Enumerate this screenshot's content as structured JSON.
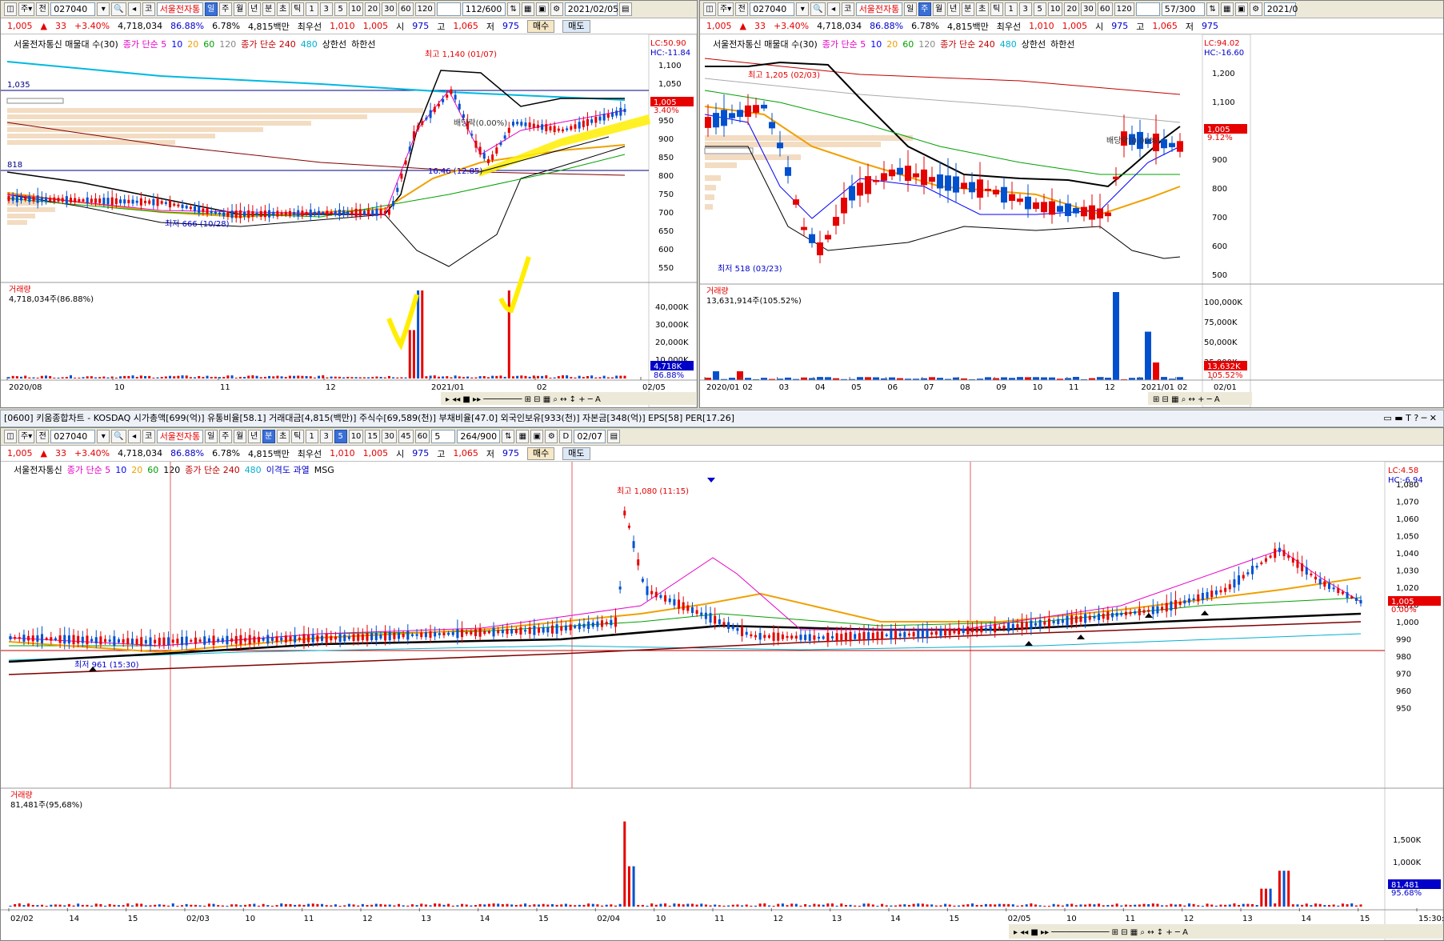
{
  "common": {
    "code": "027040",
    "name": "서울전자통",
    "mode_labels": [
      "일",
      "주",
      "월",
      "년",
      "분",
      "초",
      "틱"
    ],
    "periods_daily": [
      "1",
      "3",
      "5",
      "10",
      "20",
      "30",
      "60",
      "120"
    ],
    "periods_min": [
      "1",
      "3",
      "5",
      "10",
      "15",
      "30",
      "45",
      "60"
    ],
    "price": "1,005",
    "change": "33",
    "change_pct": "+3.40%",
    "volume": "4,718,034",
    "vol_ratio": "86.88%",
    "turnover": "6.78%",
    "amount": "4,815백만",
    "best_ask_label": "최우선",
    "best_ask": "1,010",
    "best_bid": "1,005",
    "open_label": "시",
    "open": "975",
    "high_label": "고",
    "high": "1,065",
    "low_label": "저",
    "low": "975",
    "buy": "매수",
    "sell": "매도"
  },
  "panel_daily": {
    "count": "112",
    "total": "600",
    "date": "2021/02/05",
    "legend": [
      "서울전자통신 매물대 수(30)",
      "종가 단순 5",
      "10",
      "20",
      "60",
      "120",
      "종가 단순 240",
      "480",
      "상한선",
      "하한선"
    ],
    "lc": "LC:50.90",
    "hc": "HC:-11.84",
    "high_note": "최고 1,140 (01/07)",
    "low_note": "최저 666 (10/28)",
    "div_note": "배당락(0.00%)",
    "ratio_note": "16.46 (12.85)",
    "hline1": "1,035",
    "hline2": "818",
    "cur_price": "1,005",
    "cur_pct": "3.40%",
    "y_ticks": [
      "1,100",
      "1,050",
      "1,000",
      "950",
      "900",
      "850",
      "800",
      "750",
      "700",
      "650",
      "600",
      "550"
    ],
    "vol_title": "거래량",
    "vol_value": "4,718,034주(86.88%)",
    "vol_ticks": [
      "40,000K",
      "30,000K",
      "20,000K",
      "10,000K"
    ],
    "vol_cur": "4,718K",
    "vol_pct": "86.88%",
    "x_ticks": [
      "2020/08",
      "10",
      "11",
      "12",
      "2021/01",
      "02",
      "02/05"
    ]
  },
  "panel_weekly": {
    "count": "57",
    "total": "300",
    "date": "2021/0",
    "legend": [
      "서울전자통신 매물대 수(30)",
      "종가 단순 5",
      "10",
      "20",
      "60",
      "120",
      "종가 단순 240",
      "480",
      "상한선",
      "하한선"
    ],
    "lc": "LC:94.02",
    "hc": "HC:-16.60",
    "high_note": "최고 1,205 (02/03)",
    "low_note": "최저 518 (03/23)",
    "div_note": "배당락(0.00%)",
    "cur_price": "1,005",
    "cur_pct": "9.12%",
    "y_ticks": [
      "1,200",
      "1,100",
      "1,000",
      "900",
      "800",
      "700",
      "600",
      "500"
    ],
    "vol_title": "거래량",
    "vol_value": "13,631,914주(105.52%)",
    "vol_ticks": [
      "100,000K",
      "75,000K",
      "50,000K",
      "25,000K"
    ],
    "vol_cur": "13,632K",
    "vol_pct": "105.52%",
    "x_ticks": [
      "2020/01",
      "02",
      "03",
      "04",
      "05",
      "06",
      "07",
      "08",
      "09",
      "10",
      "11",
      "12",
      "2021/01",
      "02",
      "02/01"
    ]
  },
  "bottom_title": "[0600] 키움종합차트 - KOSDAQ 시가총액[699(억)] 유통비율[58.1] 거래대금[4,815(백만)] 주식수[69,589(천)] 부채비율[47.0] 외국인보유[933(천)] 자본금[348(억)] EPS[58] PER[17.26]",
  "panel_min": {
    "interval": "5",
    "count": "264",
    "total": "900",
    "date": "02/07",
    "d_label": "D",
    "legend": [
      "서울전자통신",
      "종가 단순 5",
      "10",
      "20",
      "60",
      "120",
      "종가 단순 240",
      "480",
      "이격도 과열",
      "MSG"
    ],
    "lc": "LC:4.58",
    "hc": "HC:-6.94",
    "high_note": "최고 1,080 (11:15)",
    "low_note": "최저 961 (15:30)",
    "cur_price": "1,005",
    "cur_pct": "0.00%",
    "y_ticks": [
      "1,080",
      "1,070",
      "1,060",
      "1,050",
      "1,040",
      "1,030",
      "1,020",
      "1,010",
      "1,000",
      "990",
      "980",
      "970",
      "960",
      "950"
    ],
    "vol_title": "거래량",
    "vol_value": "81,481주(95,68%)",
    "vol_ticks": [
      "1,500K",
      "1,000K",
      "500,000"
    ],
    "vol_cur": "81,481",
    "vol_pct": "95.68%",
    "x_ticks": [
      "02/02",
      "14",
      "15",
      "02/03",
      "10",
      "11",
      "12",
      "13",
      "14",
      "15",
      "02/04",
      "10",
      "11",
      "12",
      "13",
      "14",
      "15",
      "02/05",
      "10",
      "11",
      "12",
      "13",
      "14",
      "15",
      "15:30:00"
    ]
  }
}
